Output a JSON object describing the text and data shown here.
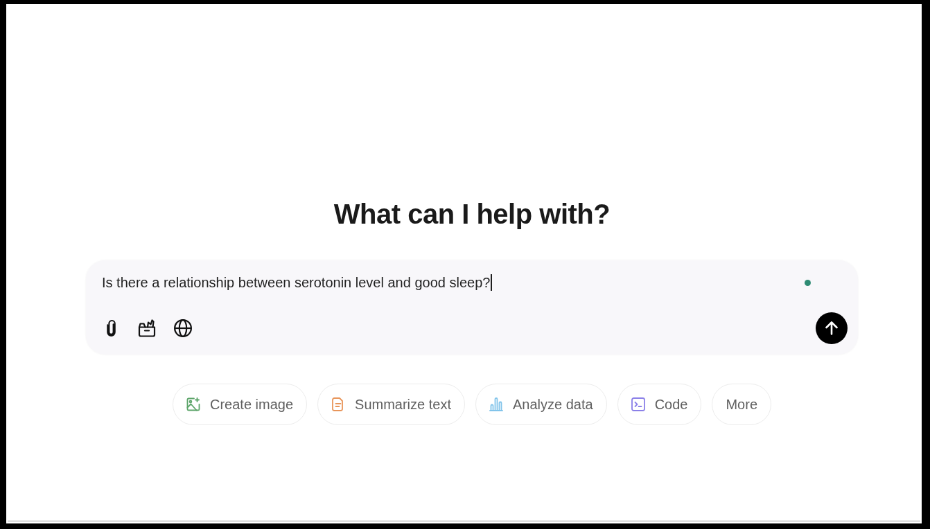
{
  "heading": "What can I help with?",
  "composer": {
    "value": "Is there a relationship between serotonin level and good sleep?",
    "focused": true
  },
  "actions": [
    {
      "label": "Create image",
      "kind": "image",
      "color": "#5ba468"
    },
    {
      "label": "Summarize text",
      "kind": "document",
      "color": "#e8955a"
    },
    {
      "label": "Analyze data",
      "kind": "chart",
      "color": "#82c4ea"
    },
    {
      "label": "Code",
      "kind": "terminal",
      "color": "#8b80e8"
    },
    {
      "label": "More",
      "kind": "plain"
    }
  ]
}
